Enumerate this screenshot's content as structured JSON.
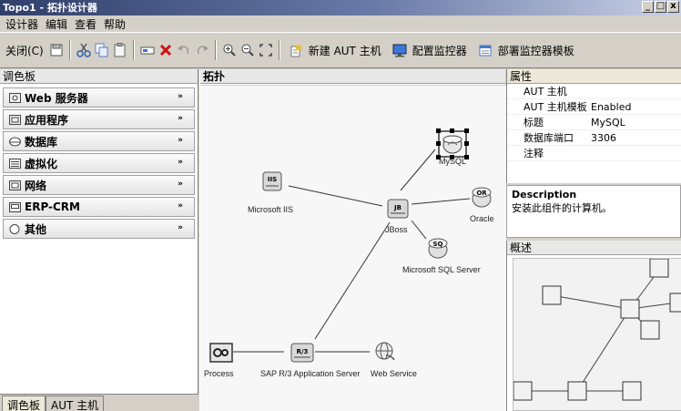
{
  "window": {
    "title": "Topo1 - 拓扑设计器",
    "min": "_",
    "max": "□",
    "close": "x"
  },
  "menu": [
    "设计器",
    "编辑",
    "查看",
    "帮助"
  ],
  "toolbar": {
    "close_label": "关闭(C)",
    "new_aut_host_label": "新建 AUT 主机",
    "configure_monitor_label": "配置监控器",
    "deploy_template_label": "部署监控器模板"
  },
  "palette": {
    "title": "调色板",
    "items": [
      {
        "label": "Web 服务器",
        "icon": "web-server-icon"
      },
      {
        "label": "应用程序",
        "icon": "application-icon"
      },
      {
        "label": "数据库",
        "icon": "database-icon"
      },
      {
        "label": "虚拟化",
        "icon": "virtualization-icon"
      },
      {
        "label": "网络",
        "icon": "network-icon"
      },
      {
        "label": "ERP-CRM",
        "icon": "erp-icon"
      },
      {
        "label": "其他",
        "icon": "other-icon"
      }
    ],
    "tabs": [
      "调色板",
      "AUT 主机"
    ]
  },
  "topology": {
    "title": "拓扑",
    "nodes": {
      "iis": {
        "label": "Microsoft IIS",
        "badge": "IIS"
      },
      "jboss": {
        "label": "JBoss",
        "badge": "JB"
      },
      "mysql": {
        "label": "MySQL"
      },
      "oracle": {
        "label": "Oracle",
        "badge": "OR"
      },
      "mssql": {
        "label": "Microsoft SQL Server",
        "badge": "SQ"
      },
      "process": {
        "label": "Process"
      },
      "sap": {
        "label": "SAP R/3 Application Server",
        "badge": "R/3"
      },
      "webservice": {
        "label": "Web Service"
      }
    }
  },
  "properties": {
    "title": "属性",
    "rows": [
      {
        "key": "AUT 主机",
        "value": ""
      },
      {
        "key": "AUT 主机模板",
        "value": "Enabled"
      },
      {
        "key": "标题",
        "value": "MySQL"
      },
      {
        "key": "数据库端口",
        "value": "3306"
      },
      {
        "key": "注释",
        "value": ""
      }
    ]
  },
  "description": {
    "title": "Description",
    "text": "安装此组件的计算机。"
  },
  "overview": {
    "title": "概述"
  }
}
